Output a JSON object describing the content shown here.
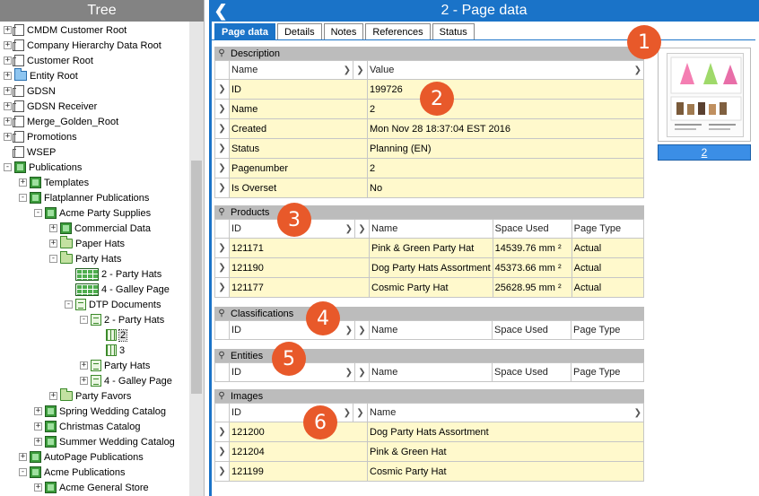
{
  "tree": {
    "title": "Tree",
    "items": [
      {
        "label": "CMDM Customer Root",
        "indent": 0,
        "expander": "+",
        "icon": "page"
      },
      {
        "label": "Company Hierarchy Data Root",
        "indent": 0,
        "expander": "+",
        "icon": "page"
      },
      {
        "label": "Customer Root",
        "indent": 0,
        "expander": "+",
        "icon": "page"
      },
      {
        "label": "Entity Root",
        "indent": 0,
        "expander": "+",
        "icon": "bluefolder"
      },
      {
        "label": "GDSN",
        "indent": 0,
        "expander": "+",
        "icon": "page"
      },
      {
        "label": "GDSN Receiver",
        "indent": 0,
        "expander": "+",
        "icon": "page"
      },
      {
        "label": "Merge_Golden_Root",
        "indent": 0,
        "expander": "+",
        "icon": "page"
      },
      {
        "label": "Promotions",
        "indent": 0,
        "expander": "+",
        "icon": "page"
      },
      {
        "label": "WSEP",
        "indent": 0,
        "expander": "",
        "icon": "page"
      },
      {
        "label": "Publications",
        "indent": 0,
        "expander": "-",
        "icon": "pub"
      },
      {
        "label": "Templates",
        "indent": 1,
        "expander": "+",
        "icon": "pub"
      },
      {
        "label": "Flatplanner Publications",
        "indent": 1,
        "expander": "-",
        "icon": "pub"
      },
      {
        "label": "Acme Party Supplies",
        "indent": 2,
        "expander": "-",
        "icon": "pub"
      },
      {
        "label": "Commercial Data",
        "indent": 3,
        "expander": "+",
        "icon": "pub"
      },
      {
        "label": "Paper Hats",
        "indent": 3,
        "expander": "+",
        "icon": "folder"
      },
      {
        "label": "Party Hats",
        "indent": 3,
        "expander": "-",
        "icon": "folder"
      },
      {
        "label": "2 - Party Hats",
        "indent": 4,
        "expander": "",
        "icon": "grid"
      },
      {
        "label": "4 - Galley Page",
        "indent": 4,
        "expander": "",
        "icon": "grid"
      },
      {
        "label": "DTP Documents",
        "indent": 4,
        "expander": "-",
        "icon": "doc"
      },
      {
        "label": "2 - Party Hats",
        "indent": 5,
        "expander": "-",
        "icon": "doc"
      },
      {
        "label": "2",
        "indent": 6,
        "expander": "",
        "icon": "small",
        "selected": true
      },
      {
        "label": "3",
        "indent": 6,
        "expander": "",
        "icon": "small"
      },
      {
        "label": "Party Hats",
        "indent": 5,
        "expander": "+",
        "icon": "doc"
      },
      {
        "label": "4 - Galley Page",
        "indent": 5,
        "expander": "+",
        "icon": "doc"
      },
      {
        "label": "Party Favors",
        "indent": 3,
        "expander": "+",
        "icon": "folder"
      },
      {
        "label": "Spring Wedding Catalog",
        "indent": 2,
        "expander": "+",
        "icon": "pub"
      },
      {
        "label": "Christmas Catalog",
        "indent": 2,
        "expander": "+",
        "icon": "pub"
      },
      {
        "label": "Summer Wedding Catalog",
        "indent": 2,
        "expander": "+",
        "icon": "pub"
      },
      {
        "label": "AutoPage Publications",
        "indent": 1,
        "expander": "+",
        "icon": "pub"
      },
      {
        "label": "Acme Publications",
        "indent": 1,
        "expander": "-",
        "icon": "pub"
      },
      {
        "label": "Acme General Store",
        "indent": 2,
        "expander": "+",
        "icon": "pub"
      }
    ]
  },
  "main": {
    "title": "2 - Page data",
    "back_icon": "back-arrow-icon",
    "tabs": [
      "Page data",
      "Details",
      "Notes",
      "References",
      "Status"
    ],
    "active_tab": 0,
    "description": {
      "title": "Description",
      "col_name": "Name",
      "col_value": "Value",
      "rows": [
        {
          "name": "ID",
          "value": "199726"
        },
        {
          "name": "Name",
          "value": "2"
        },
        {
          "name": "Created",
          "value": "Mon Nov 28 18:37:04 EST 2016"
        },
        {
          "name": "Status",
          "value": "Planning (EN)"
        },
        {
          "name": "Pagenumber",
          "value": "2"
        },
        {
          "name": "Is Overset",
          "value": "No"
        }
      ]
    },
    "products": {
      "title": "Products",
      "cols": [
        "ID",
        "Name",
        "Space Used",
        "Page Type"
      ],
      "rows": [
        {
          "id": "121171",
          "name": "Pink & Green Party Hat",
          "space": "14539.76 mm ²",
          "type": "Actual"
        },
        {
          "id": "121190",
          "name": "Dog Party Hats Assortment",
          "space": "45373.66 mm ²",
          "type": "Actual"
        },
        {
          "id": "121177",
          "name": "Cosmic Party Hat",
          "space": "25628.95 mm ²",
          "type": "Actual"
        }
      ]
    },
    "classifications": {
      "title": "Classifications",
      "cols": [
        "ID",
        "Name",
        "Space Used",
        "Page Type"
      ]
    },
    "entities": {
      "title": "Entities",
      "cols": [
        "ID",
        "Name",
        "Space Used",
        "Page Type"
      ]
    },
    "images": {
      "title": "Images",
      "cols": [
        "ID",
        "Name"
      ],
      "rows": [
        {
          "id": "121200",
          "name": "Dog Party Hats Assortment"
        },
        {
          "id": "121204",
          "name": "Pink & Green Hat"
        },
        {
          "id": "121199",
          "name": "Cosmic Party Hat"
        }
      ]
    },
    "thumbnail": {
      "label": "2"
    },
    "badges": [
      "1",
      "2",
      "3",
      "4",
      "5",
      "6"
    ]
  }
}
